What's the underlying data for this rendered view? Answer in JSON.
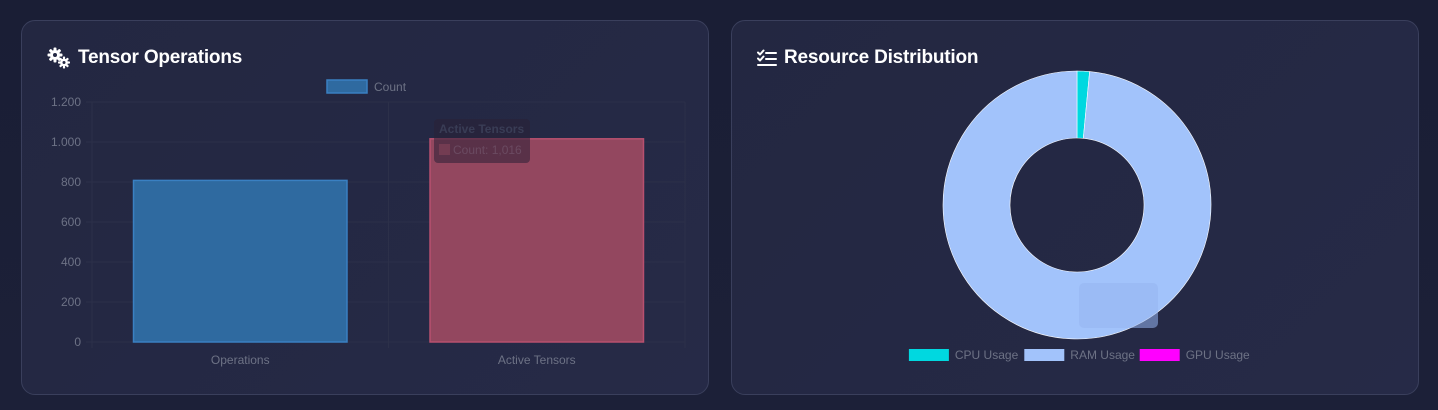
{
  "panels": {
    "tensor": {
      "title": "Tensor Operations",
      "icon": "gears-icon"
    },
    "resource": {
      "title": "Resource Distribution",
      "icon": "list-check-icon"
    }
  },
  "tooltips": {
    "bar": {
      "title": "Active Tensors",
      "line": "Count: 1,016"
    }
  },
  "chart_data": [
    {
      "type": "bar",
      "categories": [
        "Operations",
        "Active Tensors"
      ],
      "series": [
        {
          "name": "Count",
          "values": [
            808,
            1016
          ],
          "colors": [
            "#2f6aa0",
            "#93475f"
          ]
        }
      ],
      "ylim": [
        0,
        1200
      ],
      "yticks": [
        "0",
        "200",
        "400",
        "600",
        "800",
        "1.000",
        "1.200"
      ],
      "ytick_values": [
        0,
        200,
        400,
        600,
        800,
        1000,
        1200
      ],
      "grid": true,
      "legend": "top",
      "legend_color": "#2f6aa0"
    },
    {
      "type": "pie",
      "labels": [
        "CPU Usage",
        "RAM Usage",
        "GPU Usage"
      ],
      "values": [
        1.5,
        98.5,
        0
      ],
      "colors": [
        "#00d8e0",
        "#a2c3fb",
        "#ff00ff"
      ],
      "legend": "bottom"
    }
  ]
}
